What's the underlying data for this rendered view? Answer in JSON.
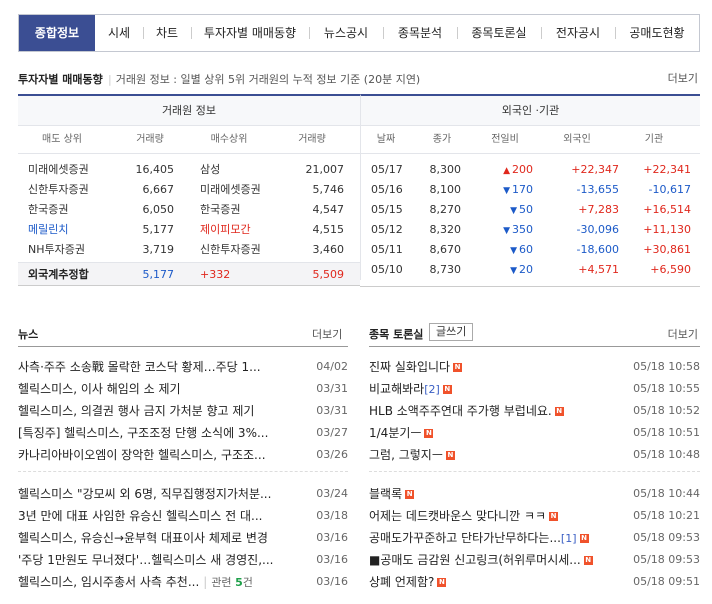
{
  "tabs": [
    "종합정보",
    "시세",
    "차트",
    "투자자별 매매동향",
    "뉴스공시",
    "종목분석",
    "종목토론실",
    "전자공시",
    "공매도현황"
  ],
  "investor": {
    "title": "투자자별 매매동향",
    "info": "거래원 정보 : 일별 상위 5위 거래원의 누적 정보 기준 (20분 지연)",
    "more": "더보기",
    "left_group": "거래원 정보",
    "left_headers": [
      "매도 상위",
      "거래량",
      "매수상위",
      "거래량"
    ],
    "left_rows": [
      {
        "sell": "미래에셋증권",
        "sell_vol": "16,405",
        "buy": "삼성",
        "buy_vol": "21,007",
        "sell_color": "#333",
        "buy_color": "#333"
      },
      {
        "sell": "신한투자증권",
        "sell_vol": "6,667",
        "buy": "미래에셋증권",
        "buy_vol": "5,746",
        "sell_color": "#333",
        "buy_color": "#333"
      },
      {
        "sell": "한국증권",
        "sell_vol": "6,050",
        "buy": "한국증권",
        "buy_vol": "4,547",
        "sell_color": "#333",
        "buy_color": "#333"
      },
      {
        "sell": "메릴린치",
        "sell_vol": "5,177",
        "buy": "제이피모간",
        "buy_vol": "4,515",
        "sell_color": "#1c5ac8",
        "buy_color": "#e0281d"
      },
      {
        "sell": "NH투자증권",
        "sell_vol": "3,719",
        "buy": "신한투자증권",
        "buy_vol": "3,460",
        "sell_color": "#333",
        "buy_color": "#333"
      }
    ],
    "foreign_row": {
      "label": "외국계추정합",
      "sell_vol": "5,177",
      "diff": "+332",
      "buy_vol": "5,509"
    },
    "right_group": "외국인 ·기관",
    "right_headers": [
      "날짜",
      "종가",
      "전일비",
      "외국인",
      "기관"
    ],
    "right_rows": [
      {
        "date": "05/17",
        "close": "8,300",
        "dir": "▲",
        "change": "200",
        "foreign": "+22,347",
        "inst": "+22,341"
      },
      {
        "date": "05/16",
        "close": "8,100",
        "dir": "▼",
        "change": "170",
        "foreign": "-13,655",
        "inst": "-10,617"
      },
      {
        "date": "05/15",
        "close": "8,270",
        "dir": "▼",
        "change": "50",
        "foreign": "+7,283",
        "inst": "+16,514"
      },
      {
        "date": "05/12",
        "close": "8,320",
        "dir": "▼",
        "change": "350",
        "foreign": "-30,096",
        "inst": "+11,130"
      },
      {
        "date": "05/11",
        "close": "8,670",
        "dir": "▼",
        "change": "60",
        "foreign": "-18,600",
        "inst": "+30,861"
      },
      {
        "date": "05/10",
        "close": "8,730",
        "dir": "▼",
        "change": "20",
        "foreign": "+4,571",
        "inst": "+6,590"
      }
    ]
  },
  "news": {
    "title": "뉴스",
    "more": "더보기",
    "items": [
      {
        "text": "사측·주주 소송戰 몰락한 코스닥 황제…주당 1...",
        "date": "04/02"
      },
      {
        "text": "헬릭스미스, 이사 해임의 소 제기",
        "date": "03/31"
      },
      {
        "text": "헬릭스미스, 의결권 행사 금지 가처분 향고 제기",
        "date": "03/31"
      },
      {
        "text": "[특징주] 헬릭스미스, 구조조정 단행 소식에 3%...",
        "date": "03/27"
      },
      {
        "text": "카나리아바이오엠이 장악한 헬릭스미스, 구조조...",
        "date": "03/26"
      },
      {
        "text": "헬릭스미스 \"강모씨 외 6명, 직무집행정지가처분...",
        "date": "03/24"
      },
      {
        "text": "3년 만에 대표 사임한 유승신 헬릭스미스 전 대...",
        "date": "03/18"
      },
      {
        "text": "헬릭스미스, 유승신→윤부혁 대표이사 체제로 변경",
        "date": "03/16"
      },
      {
        "text": "'주당 1만원도 무너졌다'…헬릭스미스 새 경영진,...",
        "date": "03/16"
      },
      {
        "text": "헬릭스미스, 임시주총서 사측 추천...",
        "date": "03/16",
        "related": "관련 ",
        "related_count": "5",
        "related_unit": "건"
      }
    ]
  },
  "board": {
    "title": "종목 토론실",
    "write": "글쓰기",
    "more": "더보기",
    "new_badge": "N",
    "items": [
      {
        "text": "진짜 실화입니다",
        "date": "05/18 10:58",
        "extra": ""
      },
      {
        "text": "비교해봐라",
        "date": "05/18 10:55",
        "extra": "[2]"
      },
      {
        "text": "HLB 소액주주연대 주가행 부럽네요.",
        "date": "05/18 10:52",
        "extra": ""
      },
      {
        "text": "1/4분기ㅡ",
        "date": "05/18 10:51",
        "extra": ""
      },
      {
        "text": "그럼, 그렇지ㅡ",
        "date": "05/18 10:48",
        "extra": ""
      },
      {
        "text": "블랙록",
        "date": "05/18 10:44",
        "extra": ""
      },
      {
        "text": "어제는 데드캣바운스 맞다니깐 ㅋㅋ",
        "date": "05/18 10:21",
        "extra": ""
      },
      {
        "text": "공매도가꾸준하고 단타가난무하다는...",
        "date": "05/18 09:53",
        "extra": "[1]"
      },
      {
        "text": "■공매도 금감원 신고링크(허위루머시세...",
        "date": "05/18 09:53",
        "extra": ""
      },
      {
        "text": "상폐 언제함?",
        "date": "05/18 09:51",
        "extra": ""
      }
    ]
  }
}
